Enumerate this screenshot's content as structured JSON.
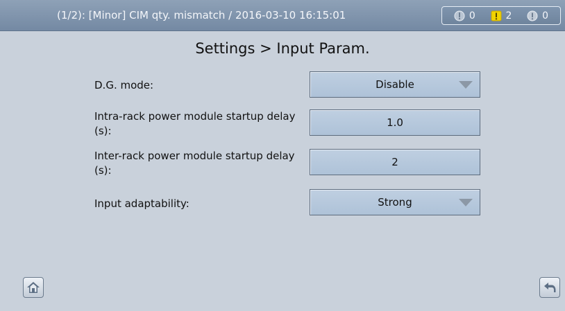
{
  "header": {
    "alarm_text": "(1/2): [Minor] CIM qty. mismatch / 2016-03-10 16:15:01",
    "counters": [
      {
        "icon": "critical-alarm-icon",
        "value": "0"
      },
      {
        "icon": "minor-alarm-icon",
        "value": "2",
        "color": "#f2d400"
      },
      {
        "icon": "warning-alarm-icon",
        "value": "0"
      }
    ]
  },
  "page": {
    "title": "Settings > Input Param."
  },
  "params": [
    {
      "label": "D.G. mode:",
      "value": "Disable",
      "type": "dropdown"
    },
    {
      "label": "Intra-rack power module startup delay (s):",
      "value": "1.0",
      "type": "input"
    },
    {
      "label": "Inter-rack power module startup delay (s):",
      "value": "2",
      "type": "input"
    },
    {
      "label": "Input adaptability:",
      "value": "Strong",
      "type": "dropdown"
    }
  ],
  "nav": {
    "home_icon": "home-icon",
    "back_icon": "back-arrow-icon"
  }
}
